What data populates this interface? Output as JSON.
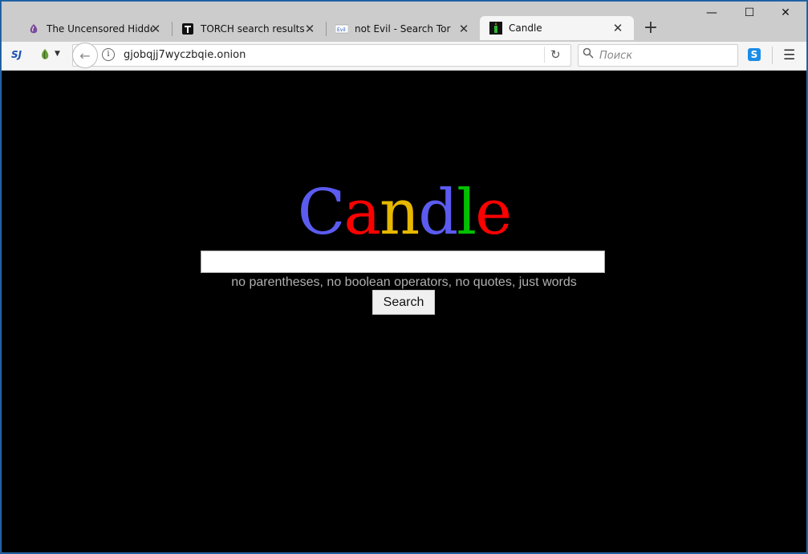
{
  "tabs": [
    {
      "title": "The Uncensored Hidde...",
      "favicon": "tor-onion-icon"
    },
    {
      "title": "TORCH search results f...",
      "favicon": "torch-icon"
    },
    {
      "title": "not Evil - Search Tor",
      "favicon": "notevil-icon"
    },
    {
      "title": "Candle",
      "favicon": "candle-icon"
    }
  ],
  "window": {
    "minimize": "—",
    "maximize": "☐",
    "close": "✕"
  },
  "newtab": "+",
  "nav": {
    "url": "gjobqjj7wyczbqie.onion",
    "search_placeholder": "Поиск",
    "sj_label": "SJ"
  },
  "page": {
    "logo_letters": [
      {
        "ch": "C",
        "color": "#5b5bf0"
      },
      {
        "ch": "a",
        "color": "#ff0000"
      },
      {
        "ch": "n",
        "color": "#e6b800"
      },
      {
        "ch": "d",
        "color": "#5b5bf0"
      },
      {
        "ch": "l",
        "color": "#00c000"
      },
      {
        "ch": "e",
        "color": "#ff0000"
      }
    ],
    "hint": "no parentheses, no boolean operators, no quotes, just words",
    "search_button": "Search",
    "query_value": ""
  }
}
